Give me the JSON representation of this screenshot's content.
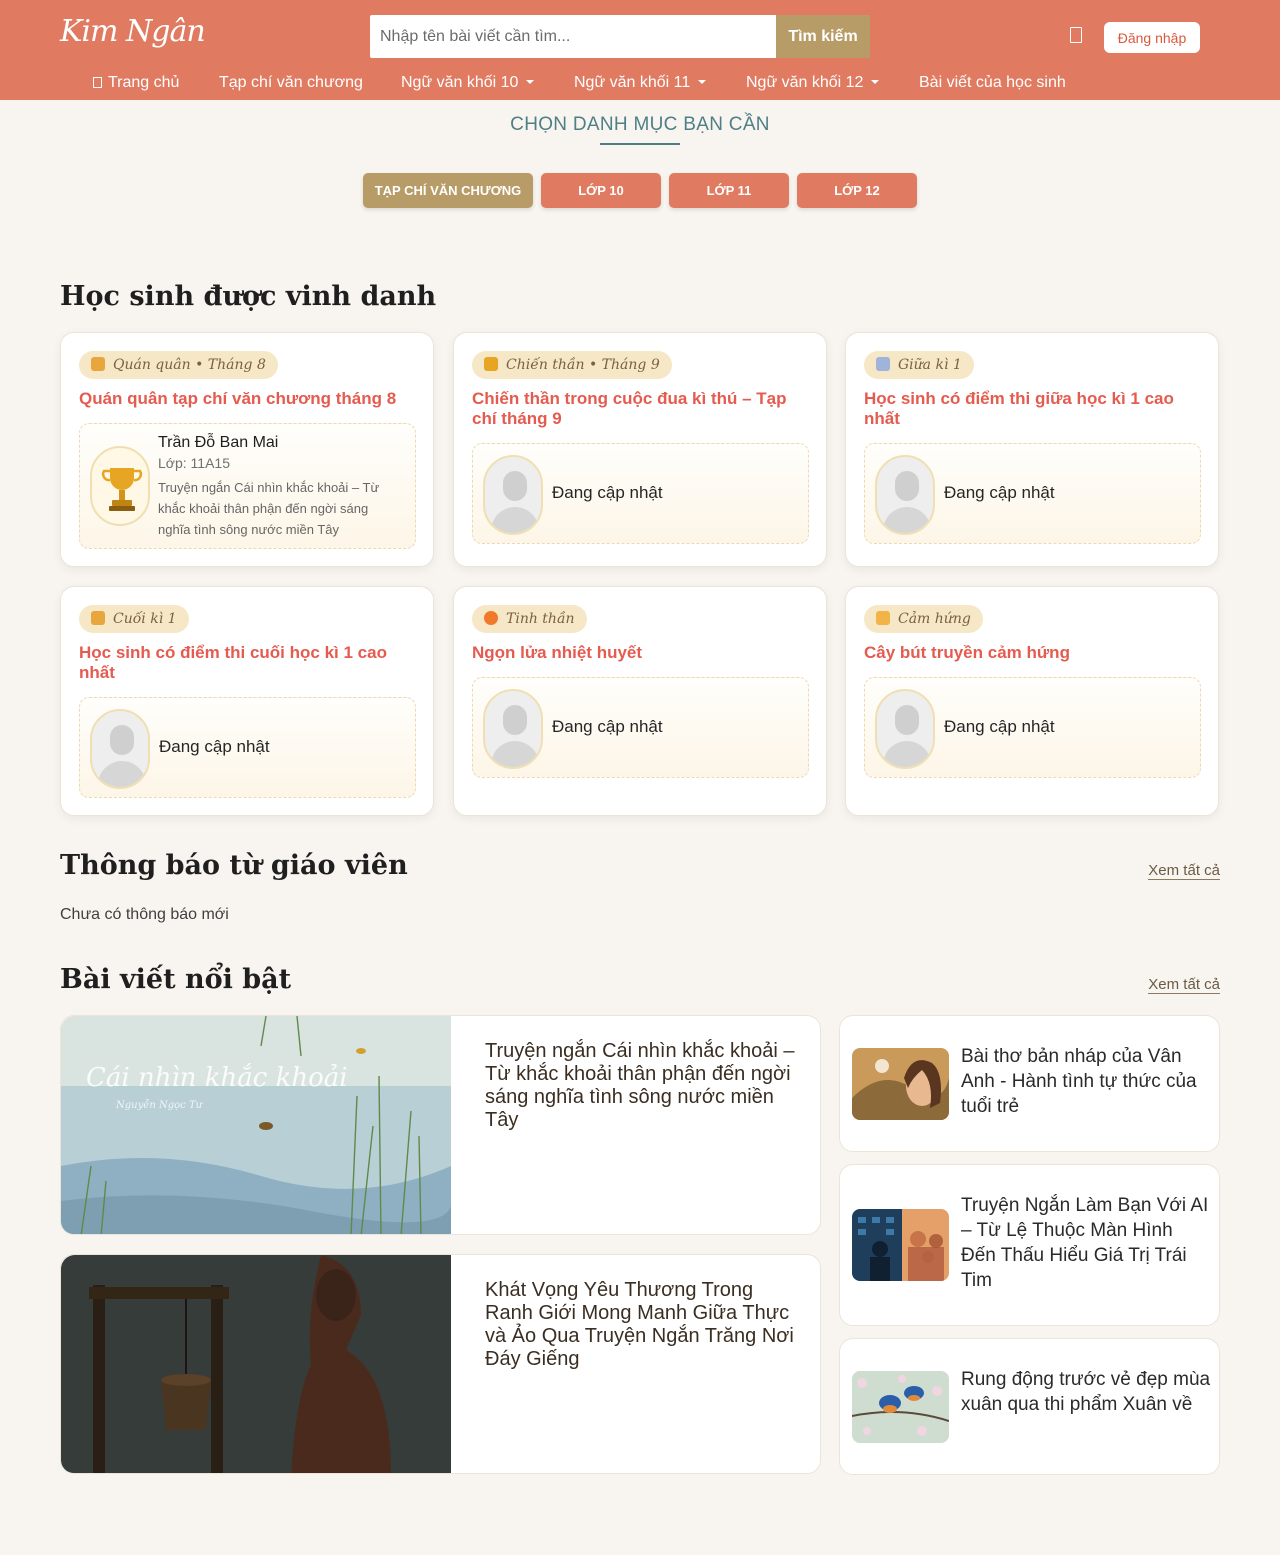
{
  "header": {
    "logo": "Kim Ngân",
    "search_placeholder": "Nhập tên bài viết cần tìm...",
    "search_button": "Tìm kiếm",
    "login_button": "Đăng nhập",
    "nav": [
      {
        "label": "Trang chủ",
        "icon": "home-icon"
      },
      {
        "label": "Tạp chí văn chương"
      },
      {
        "label": "Ngữ văn khối 10",
        "dropdown": true
      },
      {
        "label": "Ngữ văn khối 11",
        "dropdown": true
      },
      {
        "label": "Ngữ văn khối 12",
        "dropdown": true
      },
      {
        "label": "Bài viết của học sinh"
      }
    ]
  },
  "category": {
    "title": "CHỌN DANH MỤC BẠN CẦN",
    "buttons": [
      "TẠP CHÍ VĂN CHƯƠNG",
      "LỚP 10",
      "LỚP 11",
      "LỚP 12"
    ],
    "active_index": 0
  },
  "honors": {
    "title": "Học sinh được vinh danh",
    "cards": [
      {
        "badge": "Quán quân • Tháng 8",
        "badge_icon": "medal-icon",
        "heading": "Quán quân tạp chí văn chương tháng 8",
        "winner": {
          "name": "Trần Đỗ Ban Mai",
          "class": "Lớp: 11A15",
          "desc": "Truyện ngắn Cái nhìn khắc khoải – Từ khắc khoải thân phận đến ngời sáng nghĩa tình sông nước miền Tây"
        }
      },
      {
        "badge": "Chiến thần • Tháng 9",
        "badge_icon": "trophy-icon",
        "heading": "Chiến thần trong cuộc đua kì thú – Tạp chí tháng 9",
        "pending": "Đang cập nhật"
      },
      {
        "badge": "Giữa kì 1",
        "badge_icon": "chart-icon",
        "heading": "Học sinh có điểm thi giữa học kì 1 cao nhất",
        "pending": "Đang cập nhật"
      },
      {
        "badge": "Cuối kì 1",
        "badge_icon": "medal-icon",
        "heading": "Học sinh có điểm thi cuối học kì 1 cao nhất",
        "pending": "Đang cập nhật"
      },
      {
        "badge": "Tinh thần",
        "badge_icon": "fire-icon",
        "heading": "Ngọn lửa nhiệt huyết",
        "pending": "Đang cập nhật"
      },
      {
        "badge": "Cảm hứng",
        "badge_icon": "writing-hand-icon",
        "heading": "Cây bút truyền cảm hứng",
        "pending": "Đang cập nhật"
      }
    ]
  },
  "announcements": {
    "title": "Thông báo từ giáo viên",
    "see_all": "Xem tất cả",
    "empty": "Chưa có thông báo mới"
  },
  "featured": {
    "title": "Bài viết nổi bật",
    "see_all": "Xem tất cả",
    "big_posts": [
      {
        "title": "Truyện ngắn Cái nhìn khắc khoải – Từ khắc khoải thân phận đến ngời sáng nghĩa tình sông nước miền Tây",
        "thumb_text": "Cái nhìn khắc khoải",
        "thumb_author": "Nguyễn Ngọc Tư"
      },
      {
        "title": "Khát Vọng Yêu Thương Trong Ranh Giới Mong Manh Giữa Thực và Ảo Qua Truyện Ngắn Trăng Nơi Đáy Giếng"
      }
    ],
    "small_posts": [
      {
        "title": "Bài thơ bản nháp của Vân Anh - Hành tình tự thức của tuổi trẻ"
      },
      {
        "title": "Truyện Ngắn Làm Bạn Với AI – Từ Lệ Thuộc Màn Hình Đến Thấu Hiểu Giá Trị Trái Tim"
      },
      {
        "title": "Rung động trước vẻ đẹp mùa xuân qua thi phẩm Xuân về"
      }
    ]
  },
  "colors": {
    "header": "#e07b62",
    "gold": "#b89c68",
    "accent_text": "#e55b4f",
    "teal": "#4f7f86"
  }
}
